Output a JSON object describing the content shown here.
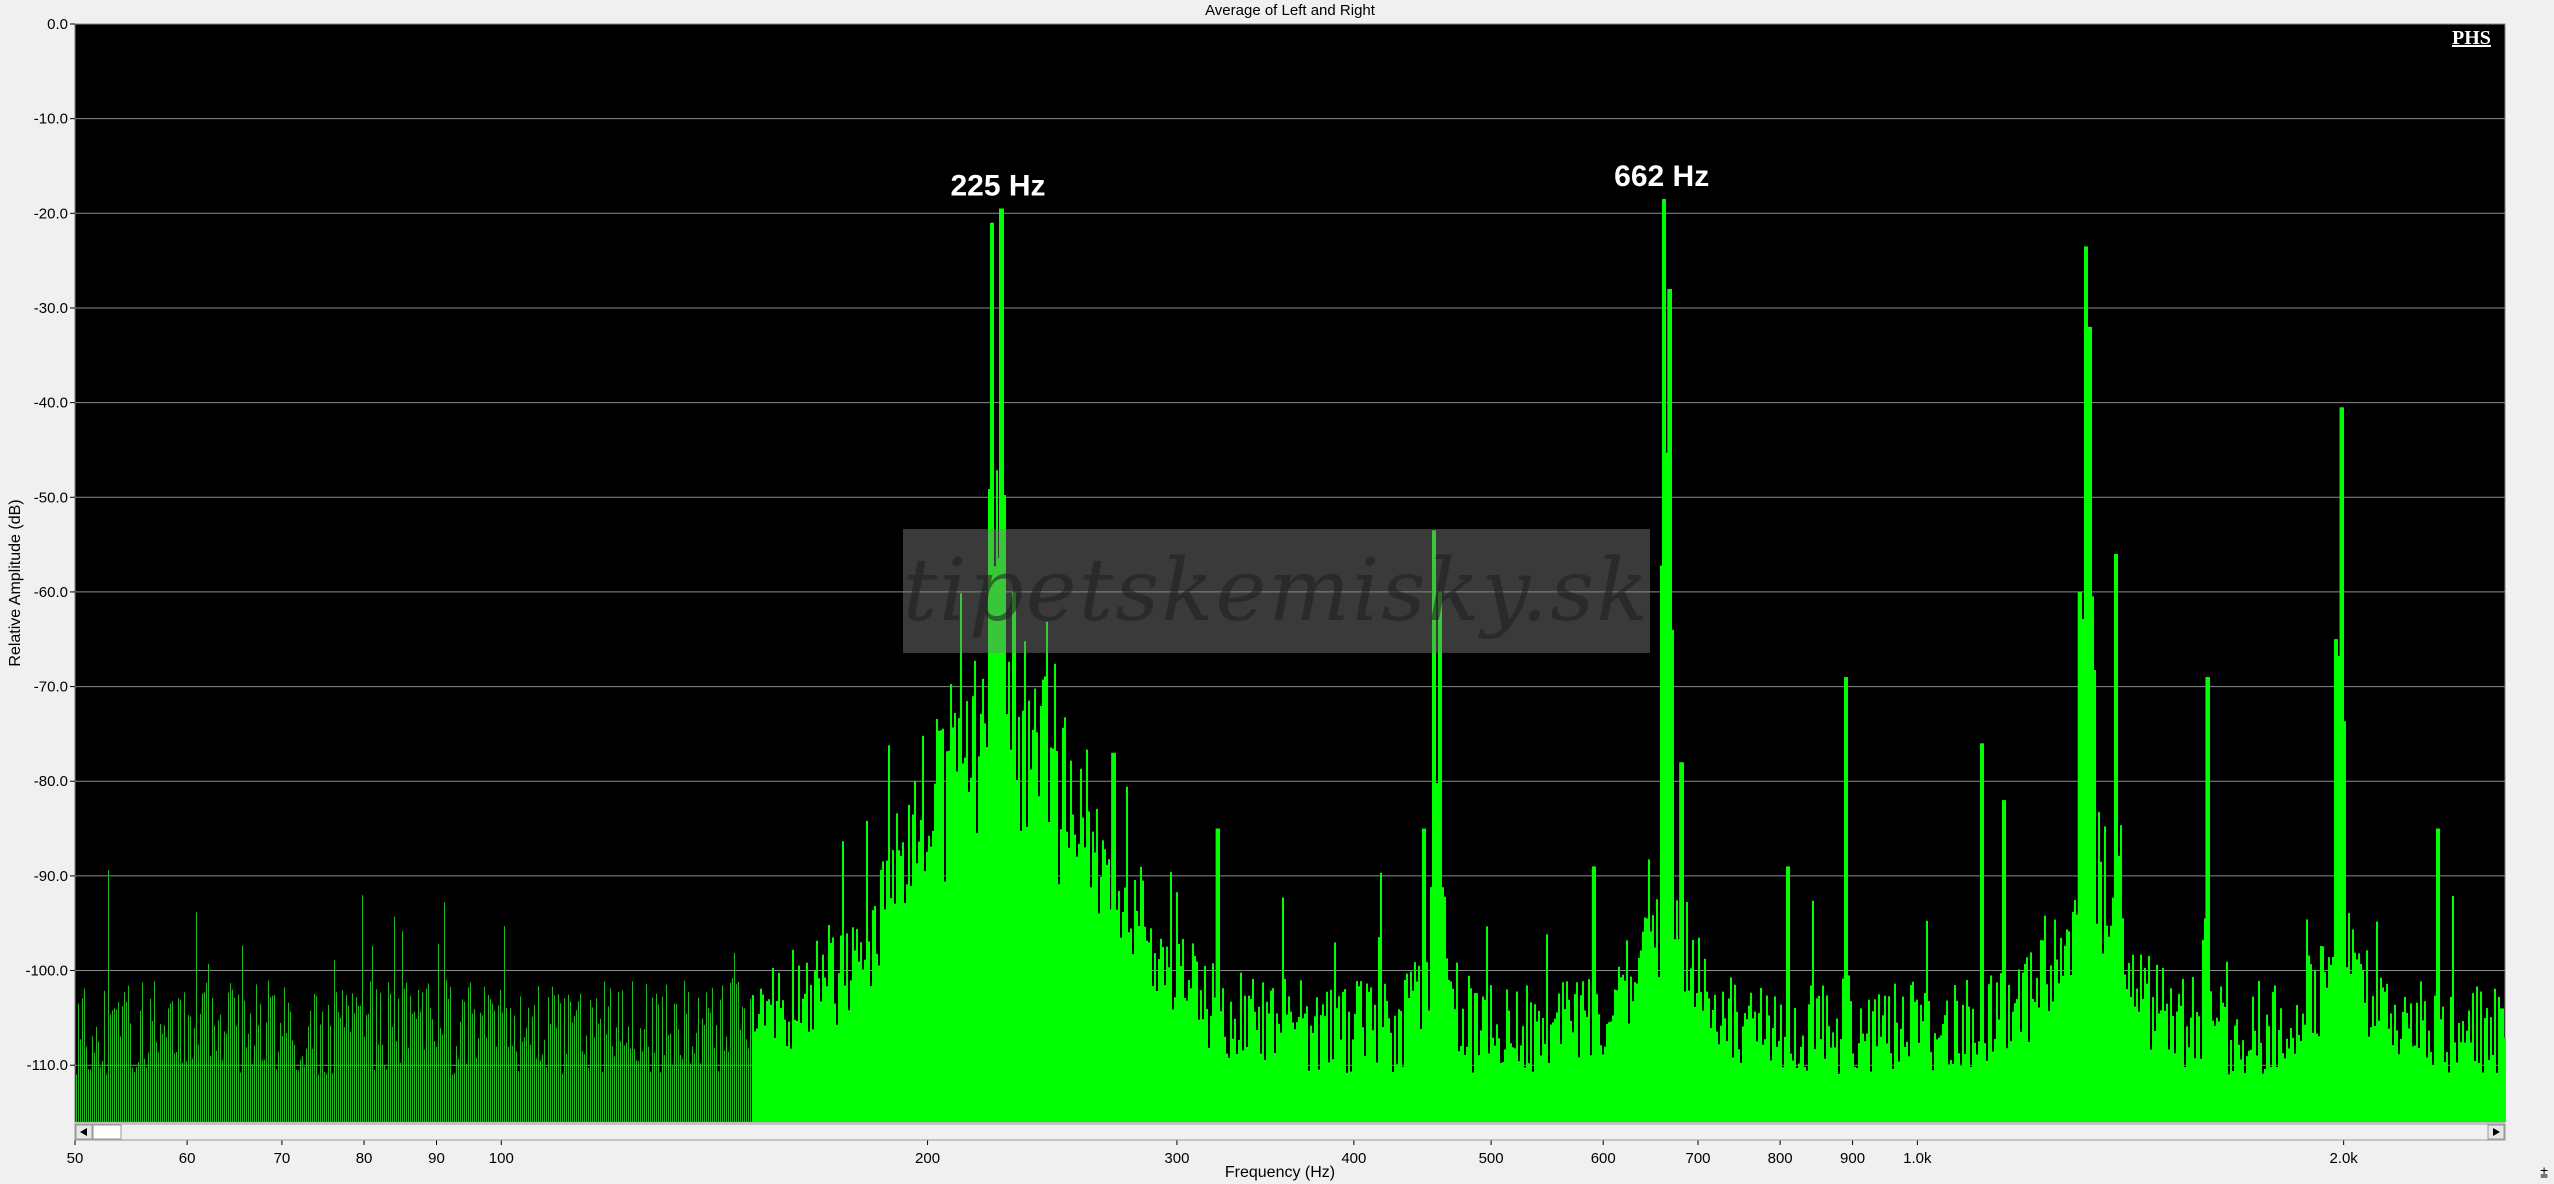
{
  "chart_data": {
    "type": "area",
    "title": "Average of Left and Right",
    "xlabel": "Frequency (Hz)",
    "ylabel": "Relative Amplitude (dB)",
    "xscale": "log",
    "xlim": [
      50,
      2600
    ],
    "ylim": [
      -116,
      0
    ],
    "x_ticks": [
      50,
      60,
      70,
      80,
      90,
      100,
      200,
      300,
      400,
      500,
      600,
      700,
      800,
      900,
      1000,
      2000
    ],
    "x_tick_labels": [
      "50",
      "60",
      "70",
      "80",
      "90",
      "100",
      "200",
      "300",
      "400",
      "500",
      "600",
      "700",
      "800",
      "900",
      "1.0k",
      "2.0k"
    ],
    "y_ticks": [
      0,
      -10,
      -20,
      -30,
      -40,
      -50,
      -60,
      -70,
      -80,
      -90,
      -100,
      -110
    ],
    "y_tick_labels": [
      "0.0",
      "-10.0",
      "-20.0",
      "-30.0",
      "-40.0",
      "-50.0",
      "-60.0",
      "-70.0",
      "-80.0",
      "-90.0",
      "-100.0",
      "-110.0"
    ],
    "grid": "horizontal",
    "background": "#000000",
    "series_color": "#00ff00",
    "noise_floor_db": -106,
    "peaks": [
      {
        "x": 225,
        "y": -19.5
      },
      {
        "x": 222,
        "y": -21
      },
      {
        "x": 230,
        "y": -60
      },
      {
        "x": 270,
        "y": -77
      },
      {
        "x": 320,
        "y": -85
      },
      {
        "x": 455,
        "y": -53.5
      },
      {
        "x": 460,
        "y": -60
      },
      {
        "x": 448,
        "y": -85
      },
      {
        "x": 590,
        "y": -89
      },
      {
        "x": 662,
        "y": -18.5
      },
      {
        "x": 667,
        "y": -28
      },
      {
        "x": 680,
        "y": -78
      },
      {
        "x": 810,
        "y": -89
      },
      {
        "x": 890,
        "y": -69
      },
      {
        "x": 1110,
        "y": -76
      },
      {
        "x": 1150,
        "y": -82
      },
      {
        "x": 1315,
        "y": -23.5
      },
      {
        "x": 1322,
        "y": -32
      },
      {
        "x": 1300,
        "y": -60
      },
      {
        "x": 1380,
        "y": -56
      },
      {
        "x": 1600,
        "y": -69
      },
      {
        "x": 1990,
        "y": -40.5
      },
      {
        "x": 1975,
        "y": -65
      },
      {
        "x": 2330,
        "y": -85
      },
      {
        "x": 2580,
        "y": -104
      }
    ],
    "annotations": [
      {
        "x": 225,
        "y": -19.5,
        "text": "225 Hz"
      },
      {
        "x": 662,
        "y": -18.5,
        "text": "662 Hz"
      }
    ]
  },
  "watermark": "tipetskemisky.sk",
  "badge": "PHS",
  "resize_grip": "⩲"
}
